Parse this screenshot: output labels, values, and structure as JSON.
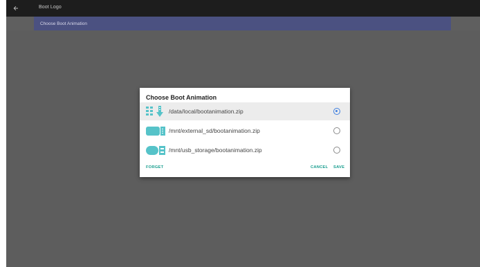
{
  "topbar": {
    "back_icon": "arrow-back-icon",
    "title": "Boot Logo"
  },
  "menu": {
    "row_label": "Choose Boot Animation"
  },
  "dialog": {
    "title": "Choose Boot Animation",
    "options": [
      {
        "label": "/data/local/bootanimation.zip",
        "icon": "internal-storage-icon",
        "selected": true
      },
      {
        "label": "/mnt/external_sd/bootanimation.zip",
        "icon": "sd-card-icon",
        "selected": false
      },
      {
        "label": "/mnt/usb_storage/bootanimation.zip",
        "icon": "usb-storage-icon",
        "selected": false
      }
    ],
    "forget_label": "FORGET",
    "cancel_label": "CANCEL",
    "save_label": "SAVE"
  },
  "colors": {
    "accent": "#1a9e8f",
    "radio": "#3f7fe0",
    "icon": "#56c3c9",
    "menu_highlight": "#4b5181"
  }
}
